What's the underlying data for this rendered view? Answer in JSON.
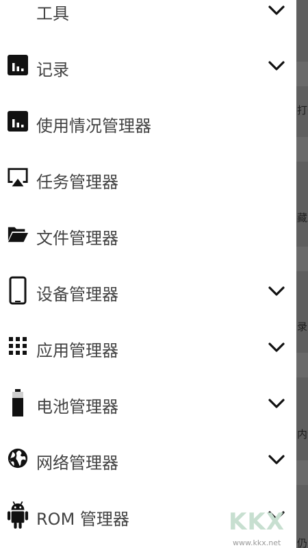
{
  "drawer": {
    "items": [
      {
        "label": "工具",
        "icon": "tools",
        "expandable": true
      },
      {
        "label": "记录",
        "icon": "bar-chart-icon",
        "expandable": true
      },
      {
        "label": "使用情况管理器",
        "icon": "bar-chart-icon",
        "expandable": false
      },
      {
        "label": "任务管理器",
        "icon": "screen-cast-icon",
        "expandable": false
      },
      {
        "label": "文件管理器",
        "icon": "folder-open-icon",
        "expandable": false
      },
      {
        "label": "设备管理器",
        "icon": "smartphone-icon",
        "expandable": true
      },
      {
        "label": "应用管理器",
        "icon": "grid-icon",
        "expandable": true
      },
      {
        "label": "电池管理器",
        "icon": "battery-icon",
        "expandable": true
      },
      {
        "label": "网络管理器",
        "icon": "globe-icon",
        "expandable": true
      },
      {
        "label": "ROM 管理器",
        "icon": "android-icon",
        "expandable": true
      }
    ]
  },
  "background": {
    "fragments": [
      "打开",
      "藏跳",
      "录",
      "内计",
      "仍"
    ]
  },
  "watermark": {
    "letters": "KKX",
    "url": "www.kkx.net"
  },
  "colors": {
    "icon": "#111111",
    "text": "#424242",
    "backdrop": "#5f5f5f"
  }
}
